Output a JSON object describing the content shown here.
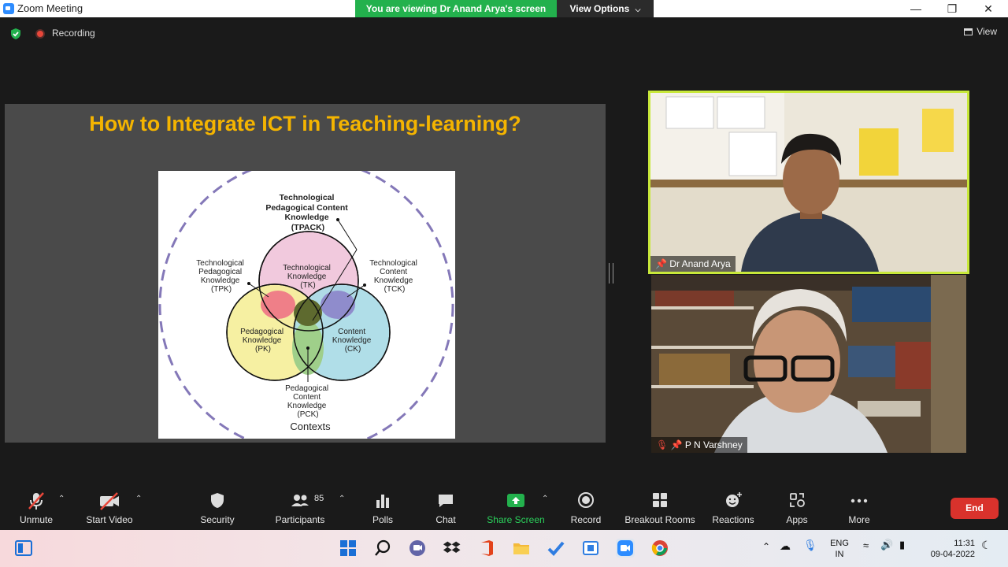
{
  "window": {
    "title": "Zoom Meeting",
    "viewing_banner": "You are viewing Dr Anand Arya's screen",
    "view_options": "View Options",
    "minimize": "—",
    "maximize": "❐",
    "close": "✕"
  },
  "topbar": {
    "recording": "Recording",
    "view": "View"
  },
  "slide": {
    "title": "How to Integrate ICT in Teaching-learning?",
    "diagram": {
      "tpack": [
        "Technological",
        "Pedagogical Content",
        "Knowledge",
        "(TPACK)"
      ],
      "tpk": [
        "Technological",
        "Pedagogical",
        "Knowledge",
        "(TPK)"
      ],
      "tck": [
        "Technological",
        "Content",
        "Knowledge",
        "(TCK)"
      ],
      "tk": [
        "Technological",
        "Knowledge",
        "(TK)"
      ],
      "pk": [
        "Pedagogical",
        "Knowledge",
        "(PK)"
      ],
      "ck": [
        "Content",
        "Knowledge",
        "(CK)"
      ],
      "pck": [
        "Pedagogical",
        "Content",
        "Knowledge",
        "(PCK)"
      ],
      "contexts": "Contexts"
    }
  },
  "participants": [
    {
      "name": "Dr Anand Arya",
      "active_speaker": true
    },
    {
      "name": "P N Varshney",
      "muted": true
    }
  ],
  "toolbar": {
    "unmute": "Unmute",
    "start_video": "Start Video",
    "security": "Security",
    "participants": "Participants",
    "participants_count": "85",
    "polls": "Polls",
    "chat": "Chat",
    "share_screen": "Share Screen",
    "record": "Record",
    "breakout_rooms": "Breakout Rooms",
    "reactions": "Reactions",
    "apps": "Apps",
    "more": "More",
    "end": "End"
  },
  "taskbar": {
    "language": "ENG",
    "region": "IN",
    "time": "11:31",
    "date": "09-04-2022"
  },
  "colors": {
    "share_green": "#23b14d",
    "slide_title": "#f4b400",
    "active_speaker_border": "#c8e83a",
    "end_red": "#d9322c"
  }
}
